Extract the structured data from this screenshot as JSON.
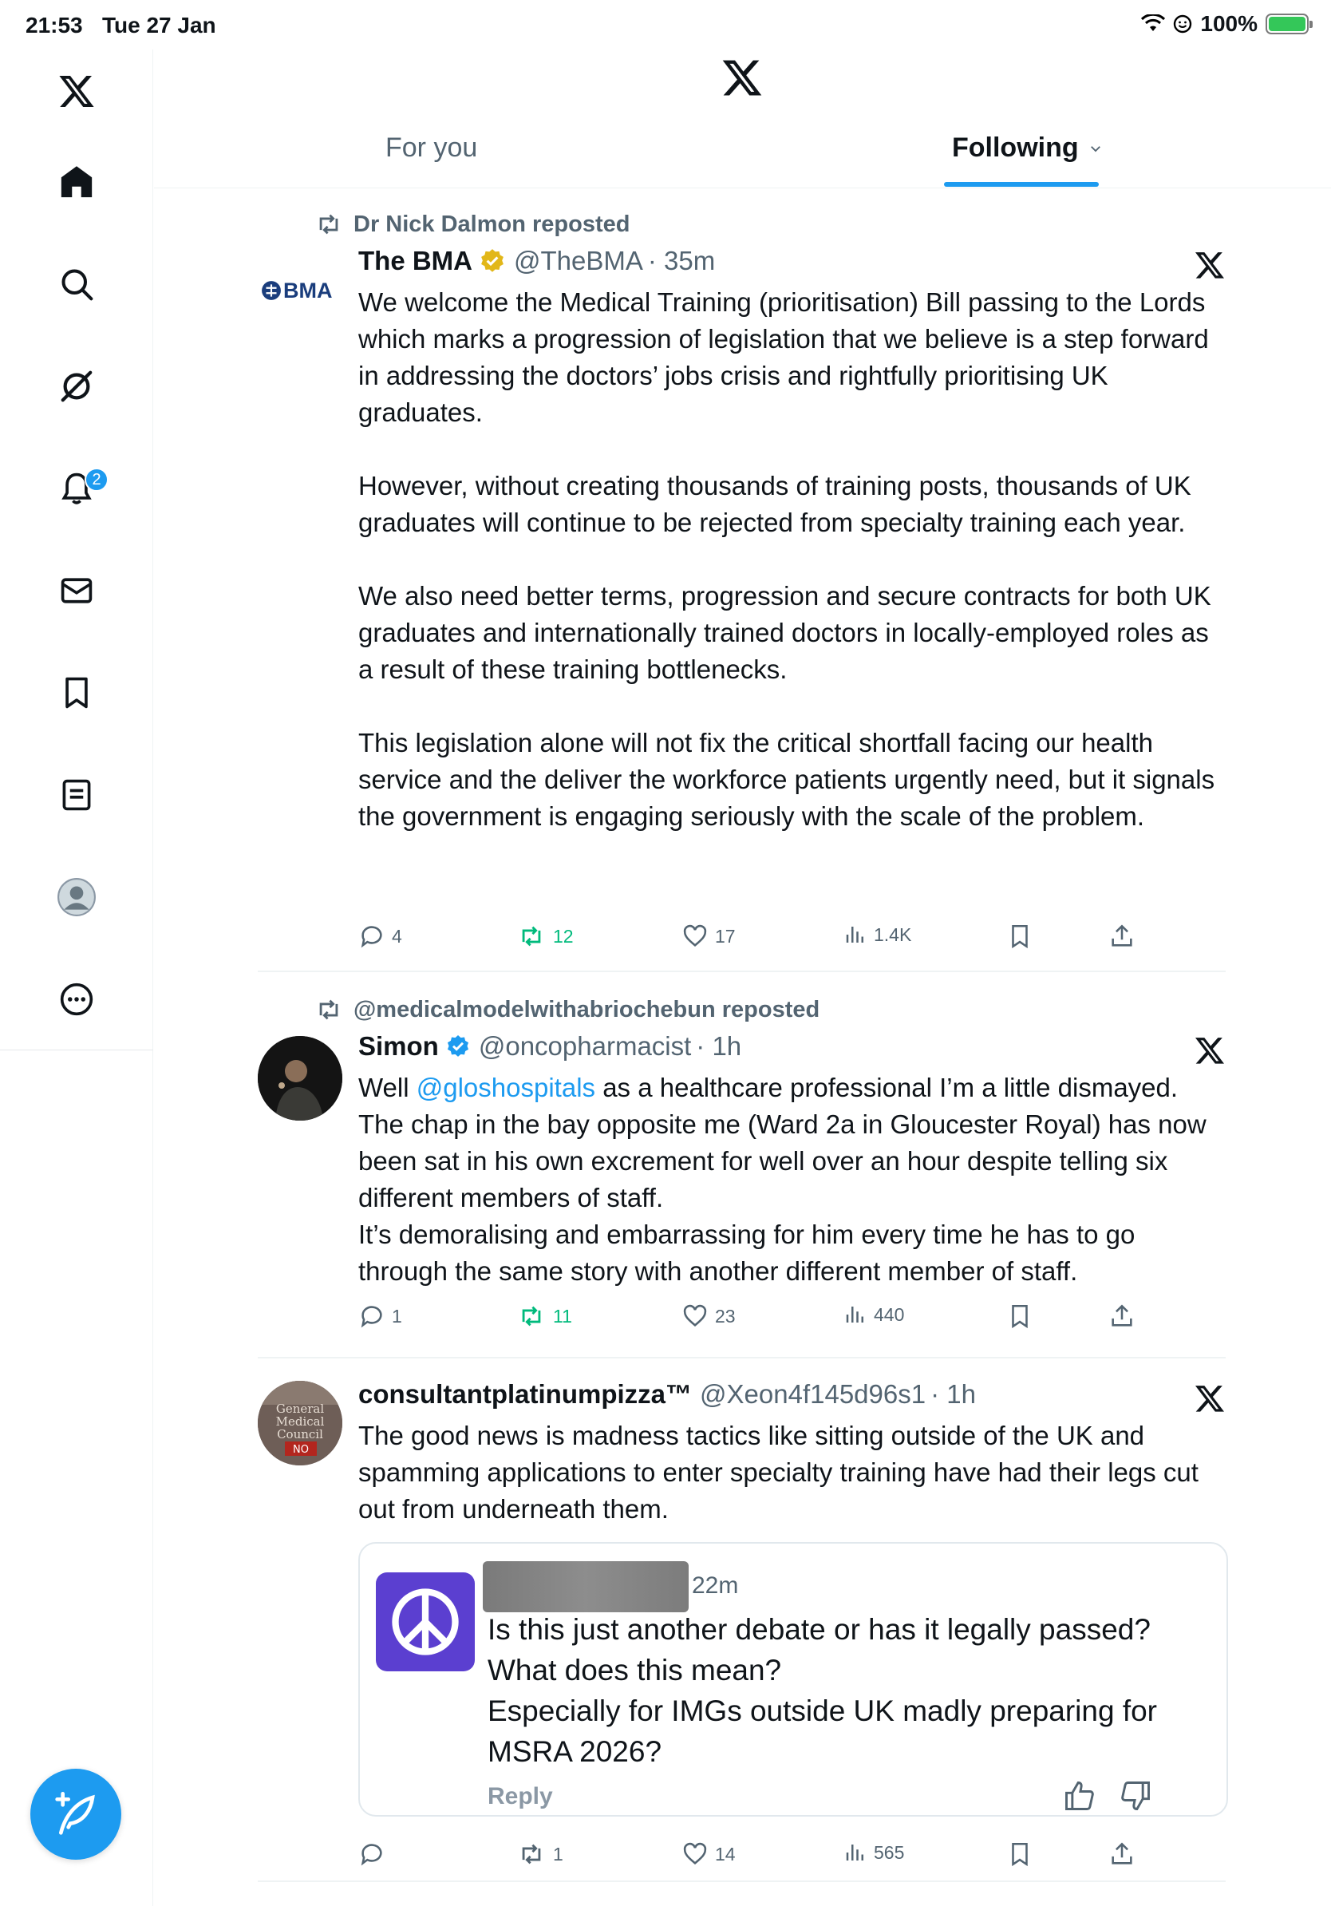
{
  "status_bar": {
    "time": "21:53",
    "date": "Tue 27 Jan",
    "battery": "100%"
  },
  "sidebar": {
    "items": [
      {
        "name": "x-logo",
        "icon": "x-logo-icon"
      },
      {
        "name": "home",
        "icon": "home-icon"
      },
      {
        "name": "search",
        "icon": "search-icon"
      },
      {
        "name": "grok",
        "icon": "grok-icon"
      },
      {
        "name": "notifications",
        "icon": "bell-icon",
        "badge": "2"
      },
      {
        "name": "messages",
        "icon": "envelope-icon"
      },
      {
        "name": "bookmarks",
        "icon": "bookmark-icon"
      },
      {
        "name": "lists",
        "icon": "list-icon"
      },
      {
        "name": "profile",
        "icon": "avatar-icon"
      },
      {
        "name": "more",
        "icon": "more-icon"
      }
    ],
    "compose_icon": "compose-icon"
  },
  "header": {
    "tabs": [
      {
        "label": "For you"
      },
      {
        "label": "Following"
      }
    ],
    "active_tab": "Following",
    "accent": "#1d9bf0"
  },
  "tweets": [
    {
      "reposted_by": "Dr Nick Dalmon reposted",
      "author": "The BMA",
      "handle": "@TheBMA",
      "time": "· 35m",
      "avatar_text": "BMA",
      "verified": "gold",
      "text": "We welcome the Medical Training (prioritisation) Bill passing to the Lords which marks a progression of legislation that we believe is a step forward in addressing the doctors’ jobs crisis and rightfully prioritising UK graduates.\n\nHowever, without creating thousands of training posts, thousands of UK graduates will continue to be rejected from specialty training each year.\n\nWe also need better terms, progression and secure contracts for both UK graduates and internationally trained doctors in locally-employed roles as a result of these training bottlenecks.\n\nThis legislation alone will not fix the critical shortfall facing our health service and the deliver the workforce patients urgently need, but it signals the government is engaging seriously with the scale of the problem.",
      "replies": "4",
      "reposts": "12",
      "likes": "17",
      "views": "1.4K"
    },
    {
      "reposted_by": "@medicalmodelwithabriochebun reposted",
      "author": "Simon",
      "handle": "@oncopharmacist",
      "time": "· 1h",
      "verified": "blue",
      "text_pre": "Well ",
      "mention": "@gloshospitals",
      "text_post": " as a healthcare professional I’m a little dismayed.\nThe chap in the bay opposite me (Ward 2a in Gloucester Royal) has now been sat in his own excrement for well over an hour despite telling six different members of staff.\nIt’s demoralising and embarrassing for him every time he has to go through the same story with another different member of staff.",
      "replies": "1",
      "reposts": "11",
      "likes": "23",
      "views": "440"
    },
    {
      "author": "consultantplatinumpizza™",
      "handle": "@Xeon4f145d96s1",
      "time": "· 1h",
      "avatar_text": "General Medical Council NO",
      "text": "The good news is madness tactics like sitting outside of the UK and spamming applications to enter specialty training have had their legs cut out from underneath them.",
      "quote": {
        "time": "22m",
        "text": "Is this just another debate or has it legally passed?\nWhat does this mean?\nEspecially for IMGs outside UK madly preparing for MSRA 2026?",
        "reply_label": "Reply"
      },
      "replies": "",
      "reposts": "1",
      "likes": "14",
      "views": "565"
    }
  ]
}
